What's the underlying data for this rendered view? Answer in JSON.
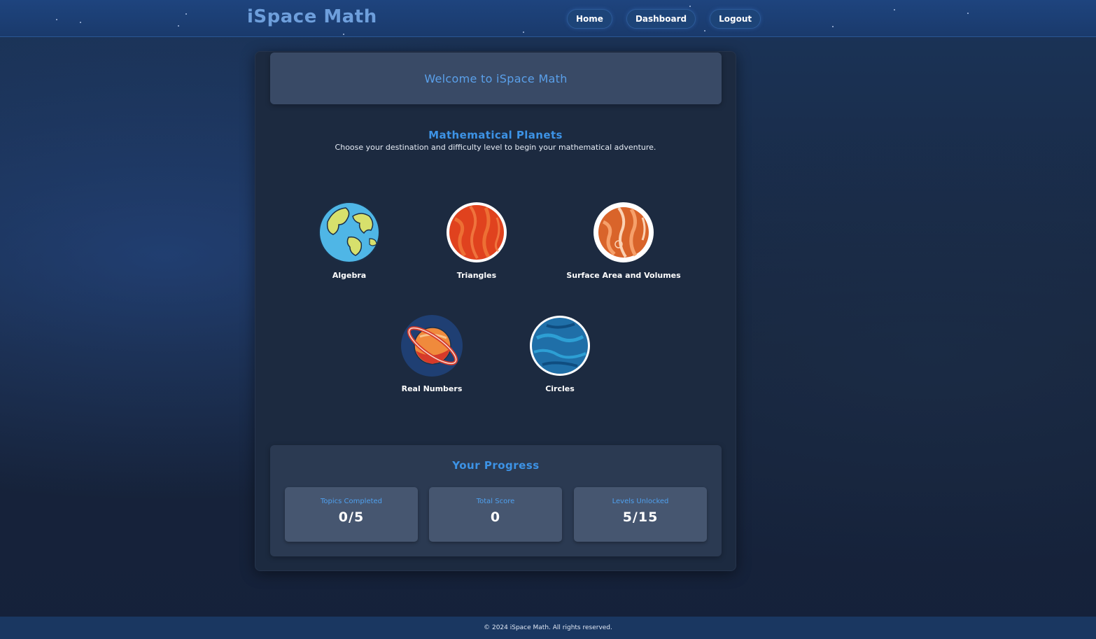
{
  "header": {
    "brand": "iSpace Math",
    "nav": [
      {
        "label": "Home"
      },
      {
        "label": "Dashboard"
      },
      {
        "label": "Logout"
      }
    ]
  },
  "welcome": {
    "text": "Welcome to iSpace Math"
  },
  "planets": {
    "title": "Mathematical Planets",
    "subtitle": "Choose your destination and difficulty level to begin your mathematical adventure.",
    "items": [
      {
        "label": "Algebra",
        "icon": "earth-planet-icon"
      },
      {
        "label": "Triangles",
        "icon": "red-planet-icon"
      },
      {
        "label": "Surface Area and Volumes",
        "icon": "orange-planet-icon"
      },
      {
        "label": "Real Numbers",
        "icon": "ringed-planet-icon"
      },
      {
        "label": "Circles",
        "icon": "blue-planet-icon"
      }
    ]
  },
  "progress": {
    "title": "Your Progress",
    "stats": [
      {
        "label": "Topics Completed",
        "value": "0/5"
      },
      {
        "label": "Total Score",
        "value": "0"
      },
      {
        "label": "Levels Unlocked",
        "value": "5/15"
      }
    ]
  },
  "footer": {
    "text": "© 2024 iSpace Math. All rights reserved."
  },
  "colors": {
    "accent": "#3d93e6",
    "background": "#17243a",
    "navbar": "#1e447e"
  }
}
